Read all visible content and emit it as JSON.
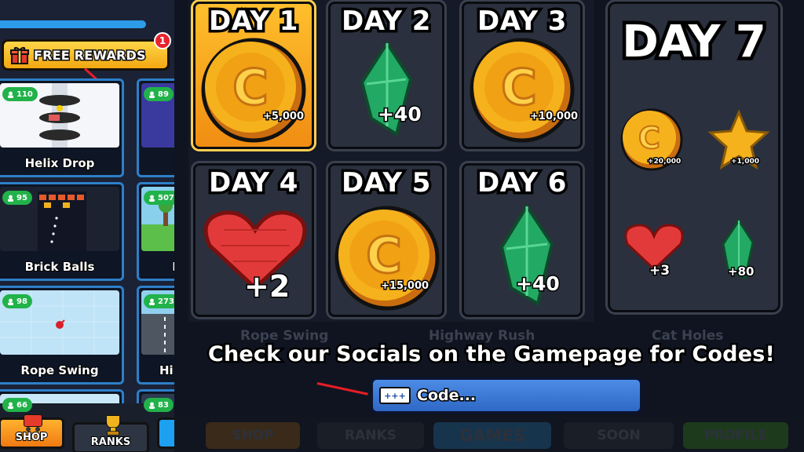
{
  "left_panel": {
    "free_rewards_label": "FREE REWARDS",
    "notification_count": "1",
    "games": [
      {
        "name": "Helix Drop",
        "players": "110"
      },
      {
        "name": "",
        "players": "89"
      },
      {
        "name": "Brick Balls",
        "players": "95"
      },
      {
        "name": "",
        "players": "507"
      },
      {
        "name": "Rope Swing",
        "players": "98"
      },
      {
        "name": "Hi",
        "players": "273"
      },
      {
        "name": "",
        "players": "66"
      },
      {
        "name": "",
        "players": "83"
      }
    ],
    "nav": {
      "shop": "SHOP",
      "ranks": "RANKS"
    }
  },
  "daily_rewards": {
    "days": [
      {
        "label": "DAY 1",
        "amount": "+5,000",
        "item": "coin",
        "status": "claimable"
      },
      {
        "label": "DAY 2",
        "amount": "+40",
        "item": "gem",
        "status": "locked"
      },
      {
        "label": "DAY 3",
        "amount": "+10,000",
        "item": "coin",
        "status": "locked"
      },
      {
        "label": "DAY 4",
        "amount": "+2",
        "item": "heart",
        "status": "locked"
      },
      {
        "label": "DAY 5",
        "amount": "+15,000",
        "item": "coin",
        "status": "locked"
      },
      {
        "label": "DAY 6",
        "amount": "+40",
        "item": "gem",
        "status": "locked"
      }
    ],
    "day7": {
      "label": "DAY 7",
      "rewards": [
        {
          "item": "coin",
          "amount": "+20,000"
        },
        {
          "item": "star",
          "amount": "+1,000"
        },
        {
          "item": "heart",
          "amount": "+3"
        },
        {
          "item": "gem",
          "amount": "+80"
        }
      ]
    }
  },
  "background_labels": [
    "Rope Swing",
    "Highway Rush",
    "Cat Holes"
  ],
  "codes": {
    "socials_text": "Check our Socials on the Gamepage for Codes!",
    "input_placeholder": "Code...",
    "keyboard_label": "+++"
  },
  "bottom_nav": [
    "SHOP",
    "RANKS",
    "GAMES",
    "SOON",
    "PROFILE"
  ],
  "colors": {
    "claim_orange": "#f5a418",
    "coin_gold": "#f6b21c",
    "gem_green": "#27b26b",
    "heart_red": "#e23a3a",
    "code_blue": "#3a7bd8",
    "arrow_red": "#e61d27"
  }
}
